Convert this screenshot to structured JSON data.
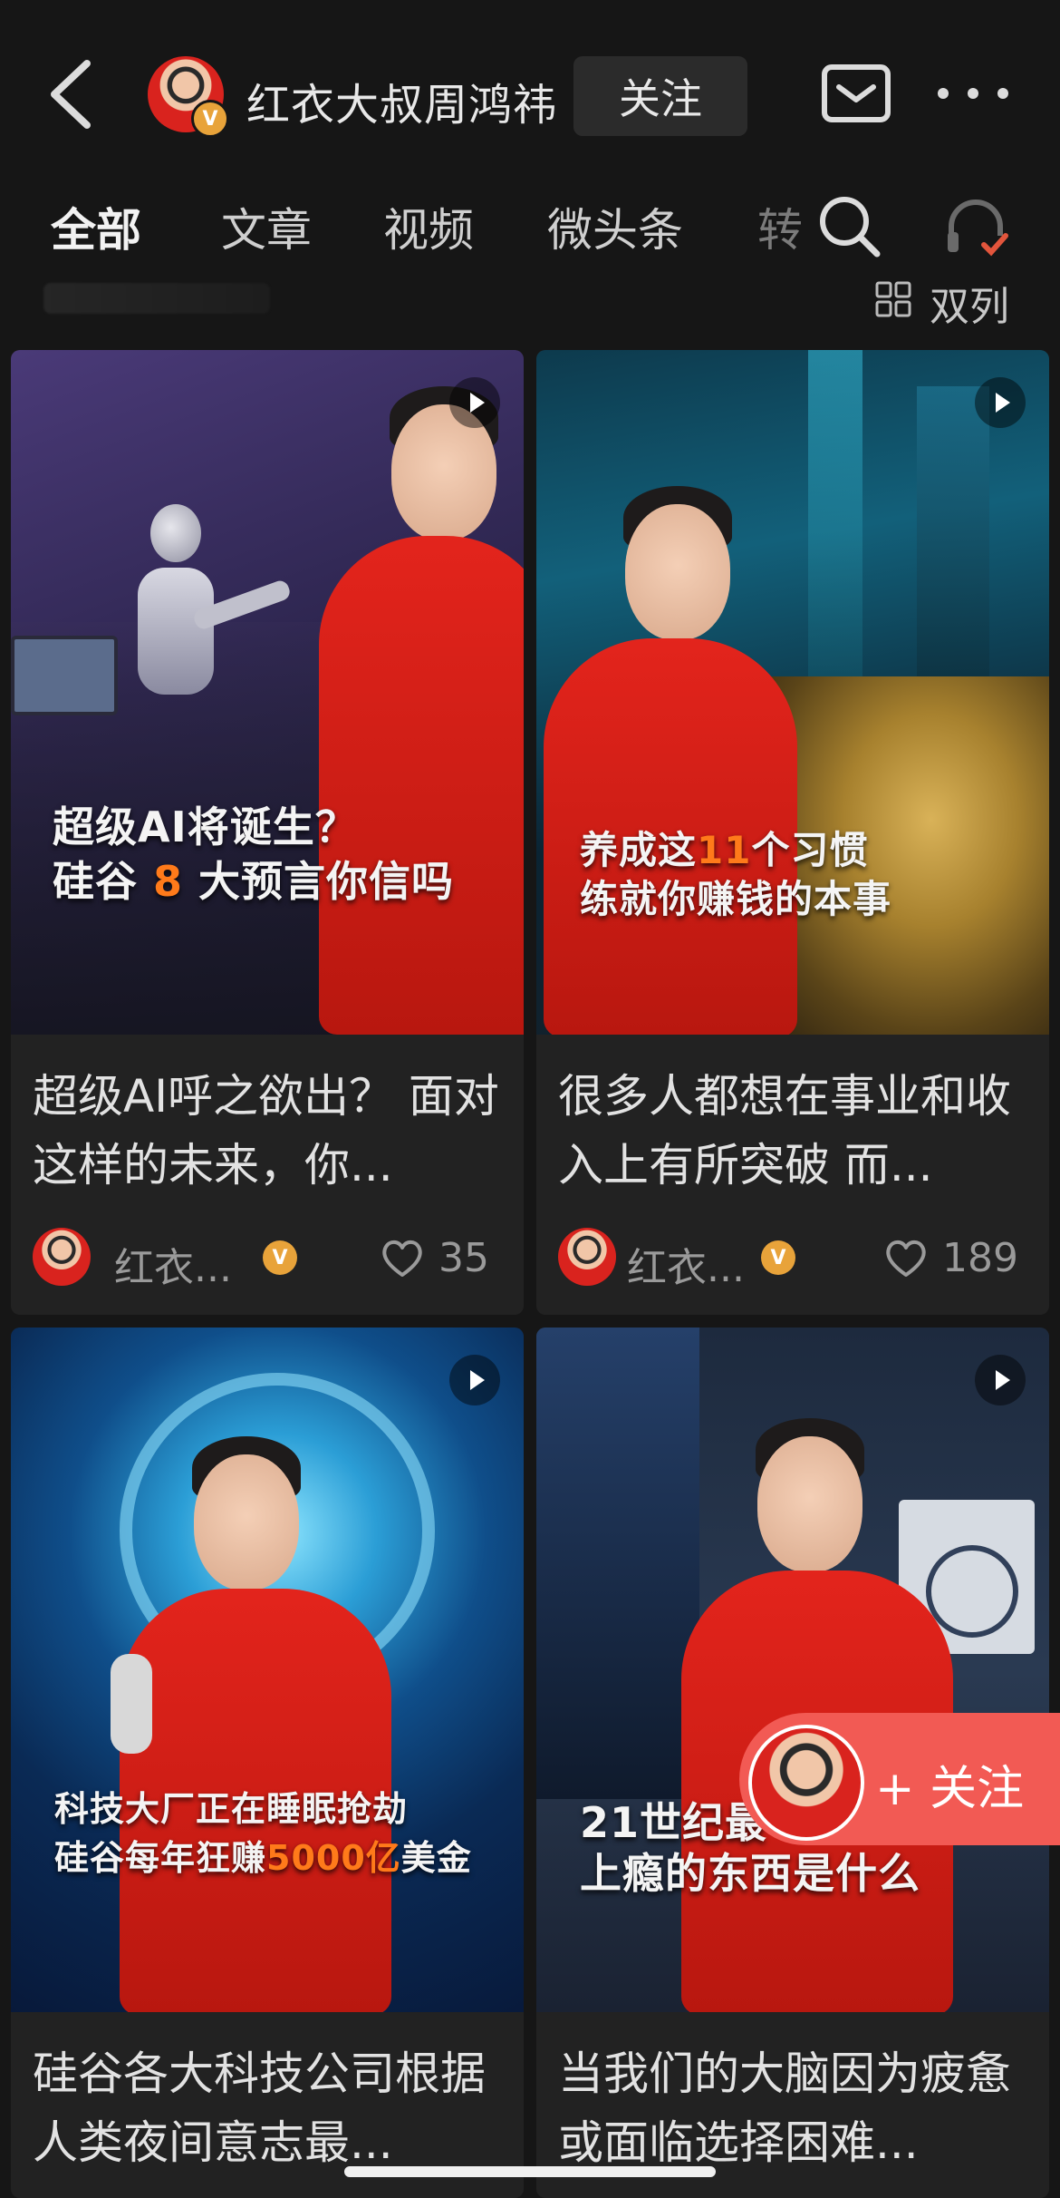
{
  "header": {
    "user_name": "红衣大叔周鸿祎",
    "follow_label": "关注",
    "verified_badge": "V"
  },
  "tabs": [
    {
      "label": "全部",
      "active": true
    },
    {
      "label": "文章",
      "active": false
    },
    {
      "label": "视频",
      "active": false
    },
    {
      "label": "微头条",
      "active": false
    },
    {
      "label": "转",
      "active": false
    }
  ],
  "toolbar": {
    "layout_label": "双列"
  },
  "cards": [
    {
      "caption_line1": "超级AI将诞生？",
      "caption_line2_pre": "硅谷 ",
      "caption_line2_hl": "8",
      "caption_line2_post": " 大预言你信吗",
      "title": "超级AI呼之欲出？ 面对这样的未来，你...",
      "author": "红衣...",
      "likes": "35"
    },
    {
      "caption_line1_pre": "养成这",
      "caption_line1_hl": "11",
      "caption_line1_post": "个习惯",
      "caption_line2": "练就你赚钱的本事",
      "title": "很多人都想在事业和收入上有所突破 而...",
      "author": "红衣...",
      "likes": "189"
    },
    {
      "caption_line1": "科技大厂正在睡眠抢劫",
      "caption_line2_pre": "硅谷每年狂赚",
      "caption_line2_hl": "5000亿",
      "caption_line2_post": "美金",
      "title": "硅谷各大科技公司根据人类夜间意志最..."
    },
    {
      "caption_line1": "21世纪最",
      "caption_line2": "上瘾的东西是什么",
      "title": "当我们的大脑因为疲惫或面临选择困难..."
    }
  ],
  "float_follow": {
    "label": "+ 关注"
  },
  "colors": {
    "background": "#161616",
    "accent_orange": "#ff7a1a",
    "follow_red": "#f25a54",
    "badge_gold": "#e8a33a"
  }
}
